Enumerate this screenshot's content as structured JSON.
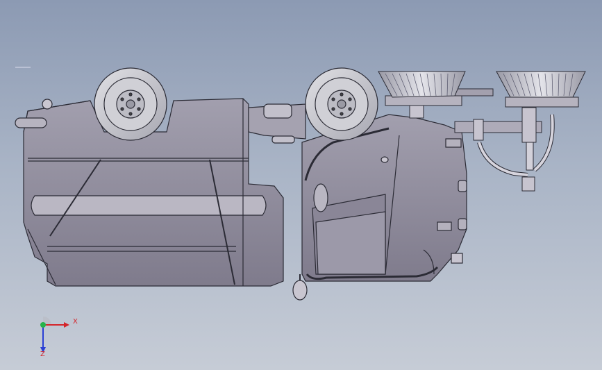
{
  "viewport": {
    "background_top": "#8c9ab3",
    "background_bottom": "#c6ccd6",
    "model_body_color": "#8f8b9b",
    "model_edge_color": "#2b2b35"
  },
  "triad": {
    "x_label": "X",
    "z_label": "Z",
    "x_color": "#d4242a",
    "y_color": "#27b34a",
    "z_color": "#2a3fd4"
  }
}
